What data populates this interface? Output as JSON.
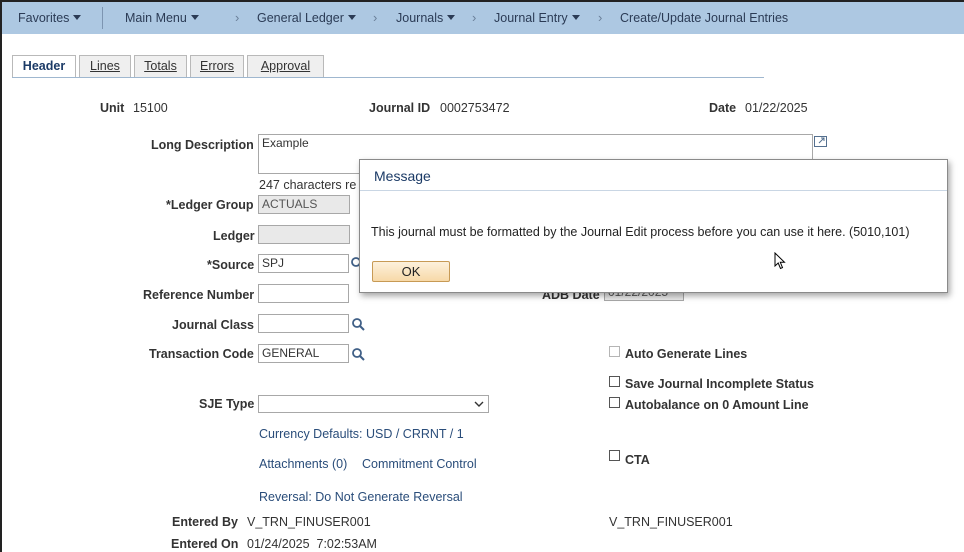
{
  "nav": {
    "favorites": "Favorites",
    "main_menu": "Main Menu",
    "breadcrumbs": [
      "General Ledger",
      "Journals",
      "Journal Entry",
      "Create/Update Journal Entries"
    ]
  },
  "tabs": [
    {
      "label": "Header"
    },
    {
      "label": "Lines"
    },
    {
      "label": "Totals"
    },
    {
      "label": "Errors"
    },
    {
      "label": "Approval"
    }
  ],
  "header": {
    "unit_label": "Unit",
    "unit_value": "15100",
    "journal_id_label": "Journal ID",
    "journal_id_value": "0002753472",
    "date_label": "Date",
    "date_value": "01/22/2025"
  },
  "form": {
    "long_description_label": "Long Description",
    "long_description_value": "Example",
    "chars_remaining": "247 characters re",
    "ledger_group_label": "*Ledger Group",
    "ledger_group_value": "ACTUALS",
    "ledger_label": "Ledger",
    "ledger_value": "",
    "source_label": "*Source",
    "source_value": "SPJ",
    "reference_number_label": "Reference Number",
    "reference_number_value": "",
    "adb_date_label": "ADB Date",
    "adb_date_value": "01/22/2025",
    "journal_class_label": "Journal Class",
    "journal_class_value": "",
    "transaction_code_label": "Transaction Code",
    "transaction_code_value": "GENERAL",
    "sje_type_label": "SJE Type",
    "sje_type_value": "",
    "currency_defaults": "Currency Defaults: USD / CRRNT / 1",
    "attachments": "Attachments (0)",
    "commitment_control": "Commitment Control",
    "reversal": "Reversal: Do Not Generate Reversal",
    "entered_by_label": "Entered By",
    "entered_by_value": "V_TRN_FINUSER001",
    "last_updated_by_value": "V_TRN_FINUSER001",
    "entered_on_label": "Entered On",
    "entered_on_value": "01/24/2025  7:02:53AM"
  },
  "options": {
    "auto_generate_lines": "Auto Generate Lines",
    "save_incomplete": "Save Journal Incomplete Status",
    "autobalance": "Autobalance on 0 Amount Line",
    "cta": "CTA"
  },
  "dialog": {
    "title": "Message",
    "message": "This journal must be formatted by the Journal Edit process before you can use it here. (5010,101)",
    "ok_label": "OK"
  },
  "colors": {
    "nav_bg": "#adc8e2",
    "link": "#2a4d7a",
    "ok_button": "#f7d9a8"
  }
}
